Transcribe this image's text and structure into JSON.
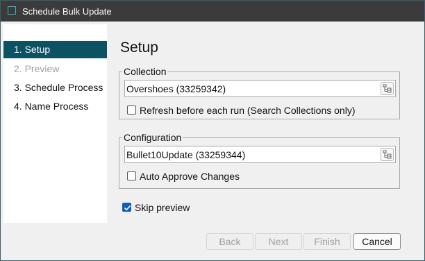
{
  "window": {
    "title": "Schedule Bulk Update"
  },
  "sidebar": {
    "steps": [
      {
        "label": "1. Setup",
        "state": "active"
      },
      {
        "label": "2. Preview",
        "state": "disabled"
      },
      {
        "label": "3. Schedule Process",
        "state": "normal"
      },
      {
        "label": "4. Name Process",
        "state": "normal"
      }
    ]
  },
  "main": {
    "title": "Setup",
    "collection": {
      "label": "Collection",
      "value": "Overshoes (33259342)",
      "option_label": "Refresh before each run (Search Collections only)",
      "option_checked": false
    },
    "configuration": {
      "label": "Configuration",
      "value": "Bullet10Update (33259344)",
      "option_label": "Auto Approve Changes",
      "option_checked": false
    },
    "skip_preview": {
      "label": "Skip preview",
      "checked": true
    }
  },
  "buttons": {
    "back": "Back",
    "next": "Next",
    "finish": "Finish",
    "cancel": "Cancel"
  },
  "colors": {
    "accent": "#0c5262",
    "titlebar": "#3b3b3b",
    "checkbox_checked": "#0f5fb0"
  },
  "icons": {
    "app": "app-icon",
    "browse": "tree-browse-icon",
    "check": "checkmark-icon"
  }
}
